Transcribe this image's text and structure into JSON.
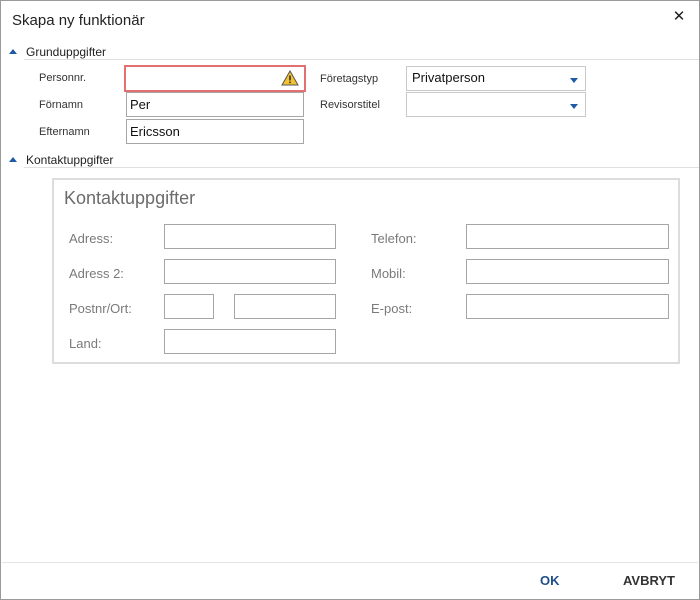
{
  "dialog": {
    "title": "Skapa ny funktionär",
    "close_symbol": "✕"
  },
  "sections": {
    "basic": {
      "label": "Grunduppgifter"
    },
    "contact": {
      "label": "Kontaktuppgifter"
    }
  },
  "basic": {
    "personnr": {
      "label": "Personnr.",
      "value": "",
      "state": "error"
    },
    "fornamn": {
      "label": "Förnamn",
      "value": "Per"
    },
    "efternamn": {
      "label": "Efternamn",
      "value": "Ericsson"
    },
    "foretagstyp": {
      "label": "Företagstyp",
      "value": "Privatperson"
    },
    "revisorstitel": {
      "label": "Revisorstitel",
      "value": ""
    }
  },
  "contact": {
    "title": "Kontaktuppgifter",
    "adress": {
      "label": "Adress:",
      "value": ""
    },
    "adress2": {
      "label": "Adress 2:",
      "value": ""
    },
    "postnr_ort": {
      "label": "Postnr/Ort:",
      "postnr": "",
      "ort": ""
    },
    "land": {
      "label": "Land:",
      "value": ""
    },
    "telefon": {
      "label": "Telefon:",
      "value": ""
    },
    "mobil": {
      "label": "Mobil:",
      "value": ""
    },
    "epost": {
      "label": "E-post:",
      "value": ""
    }
  },
  "footer": {
    "ok_label": "OK",
    "cancel_label": "AVBRYT"
  },
  "colors": {
    "accent": "#1e5aa8",
    "error_border": "#e27070",
    "warning_fill": "#f2c230"
  },
  "icons": {
    "close": "close-icon",
    "warning": "warning-icon",
    "collapse": "triangle-up-icon",
    "dropdown": "chevron-down-icon"
  }
}
